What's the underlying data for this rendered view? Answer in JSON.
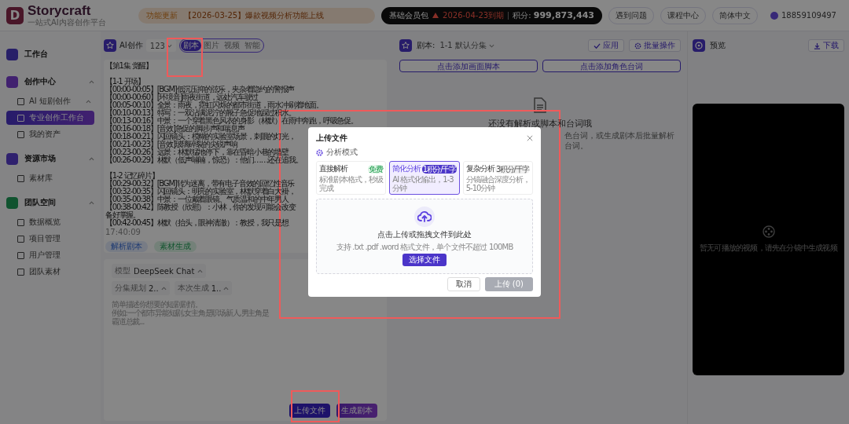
{
  "header": {
    "logo_letter": "D",
    "brand": "Storycraft",
    "tagline": "一站式AI内容创作平台",
    "notice_tag": "功能更新",
    "notice": "【2026-03-25】爆款视频分析功能上线",
    "membership": {
      "plan": "基础会员包",
      "expiry": "2026-04-23到期",
      "points_label": "积分:",
      "points": "999,873,443"
    },
    "actions": [
      "遇到问题",
      "课程中心",
      "简体中文"
    ],
    "user": "18859109497"
  },
  "sidebar": {
    "items": [
      {
        "label": "工作台",
        "kind": "workspace"
      },
      {
        "label": "创作中心",
        "kind": "create",
        "expanded": true,
        "children": [
          {
            "label": "AI 短剧创作",
            "selected": false,
            "expanded": true
          },
          {
            "label": "专业创作工作台",
            "selected": true
          },
          {
            "label": "我的资产",
            "selected": false
          }
        ]
      },
      {
        "label": "资源市场",
        "kind": "market",
        "expanded": true,
        "children": [
          {
            "label": "素材库",
            "selected": false
          }
        ]
      },
      {
        "label": "团队空间",
        "kind": "team",
        "expanded": true,
        "children": [
          {
            "label": "数据概览",
            "selected": false
          },
          {
            "label": "项目管理",
            "selected": false
          },
          {
            "label": "用户管理",
            "selected": false
          },
          {
            "label": "团队素材",
            "selected": false
          }
        ]
      }
    ]
  },
  "creator": {
    "title": "AI创作",
    "project": "123",
    "tabs": [
      {
        "label": "剧本",
        "selected": true
      },
      {
        "label": "图片",
        "selected": false
      },
      {
        "label": "视频",
        "selected": false
      },
      {
        "label": "智能",
        "selected": false
      }
    ],
    "script": {
      "title": "【第1集 觉醒】",
      "sections": [
        {
          "heading": "【1-1 开场】",
          "lines": [
            "【00:00-00:05】[BGM]低沉压抑的弦乐，夹杂着隐约的警报声",
            "【00:00-00:60】[环境音]雨夜街道，远处汽车驶过",
            "【00:05-00:10】全景：雨夜，霓虹闪烁的都市街道，雨水冲刷着地面。",
            "【00:10-00:13】特写：一双沾满泥泞的靴子急促地踩过积水。",
            "【00:13-00:16】中景：一个穿着黑色风衣的身影（林默）在雨中奔跑，呼吸急促。",
            "【00:16-00:18】[音效]急促的脚步声和喘息声",
            "【00:18-00:21】闪回镜头：模糊的实验室场景，刺眼的灯光，",
            "【00:21-00:23】[音效]玻璃碎裂的尖锐声响",
            "【00:23-00:26】远景：林默猛地停下，靠在昏暗小巷的墙壁",
            "【00:26-00:29】林默（低声喃喃，惊恐）：他们……还在追我。"
          ]
        },
        {
          "heading": "【1-2 记忆碎片】",
          "lines": [
            "【00:29-00:32】[BGM]转为迷离，带有电子音效的回忆性音乐",
            "【00:32-00:35】闪回镜头：明亮的实验室，林默穿着白大褂，",
            "【00:35-00:38】中景：一位戴着眼镜、气质温和的中年男人",
            "【00:38-00:42】陈教授（欣慰）：小林，你的发现可能会改变",
            "备好掌握。",
            "【00:42-00:45】林默（抬头，眼神清澈）：教授，我只是想"
          ]
        }
      ],
      "time": "17:40:09"
    },
    "chips": [
      {
        "label": "解析剧本",
        "kind": "parse"
      },
      {
        "label": "素材生成",
        "kind": "asset"
      }
    ],
    "generator": {
      "model_label": "模型",
      "model": "DeepSeek Chat",
      "selects": [
        {
          "label": "分集规划",
          "value": "2.."
        },
        {
          "label": "本次生成",
          "value": "1.."
        }
      ],
      "placeholder": [
        "简单描述你想要的短剧剧情。",
        "例如:一个都市异能短剧,女主角是职场新人,男主角是霸道总裁..."
      ],
      "buttons": [
        {
          "label": "上传文件",
          "kind": "upload"
        },
        {
          "label": "生成剧本",
          "kind": "generate"
        }
      ]
    }
  },
  "script_panel": {
    "label": "剧本:",
    "episode": "1-1 默认分集",
    "actions": [
      {
        "label": "应用",
        "kind": "apply"
      },
      {
        "label": "批量操作",
        "kind": "batch"
      }
    ],
    "add_buttons": [
      "点击添加画面脚本",
      "点击添加角色台词"
    ],
    "empty": {
      "title": "还没有解析或脚本和台词哦",
      "lines": [
        "色台词，或生成剧本后批量解析",
        "台词。"
      ]
    }
  },
  "preview": {
    "title": "预览",
    "download": "下载",
    "message": "暂无可播放的视频，请先在分镜中生成视频"
  },
  "dialog": {
    "title": "上传文件",
    "mode_label": "分析模式",
    "modes": [
      {
        "name": "直接解析",
        "badge": "免费",
        "kind": "free",
        "desc": "标准剧本格式，秒级完成",
        "selected": false
      },
      {
        "name": "简化分析",
        "badge": "1积分/千字",
        "kind": "paid",
        "desc": "AI 格式化输出，1-3分钟",
        "selected": true
      },
      {
        "name": "复杂分析",
        "badge": "3积分/千字",
        "kind": "paid",
        "desc": "分镜融合深度分析，5-10分钟",
        "selected": false
      }
    ],
    "drop_title": "点击上传或拖拽文件到此处",
    "drop_hint": "支持 .txt .pdf .word 格式文件，单个文件不超过 100MB",
    "choose": "选择文件",
    "cancel": "取消",
    "upload": "上传 (0)",
    "upload_disabled": true
  }
}
